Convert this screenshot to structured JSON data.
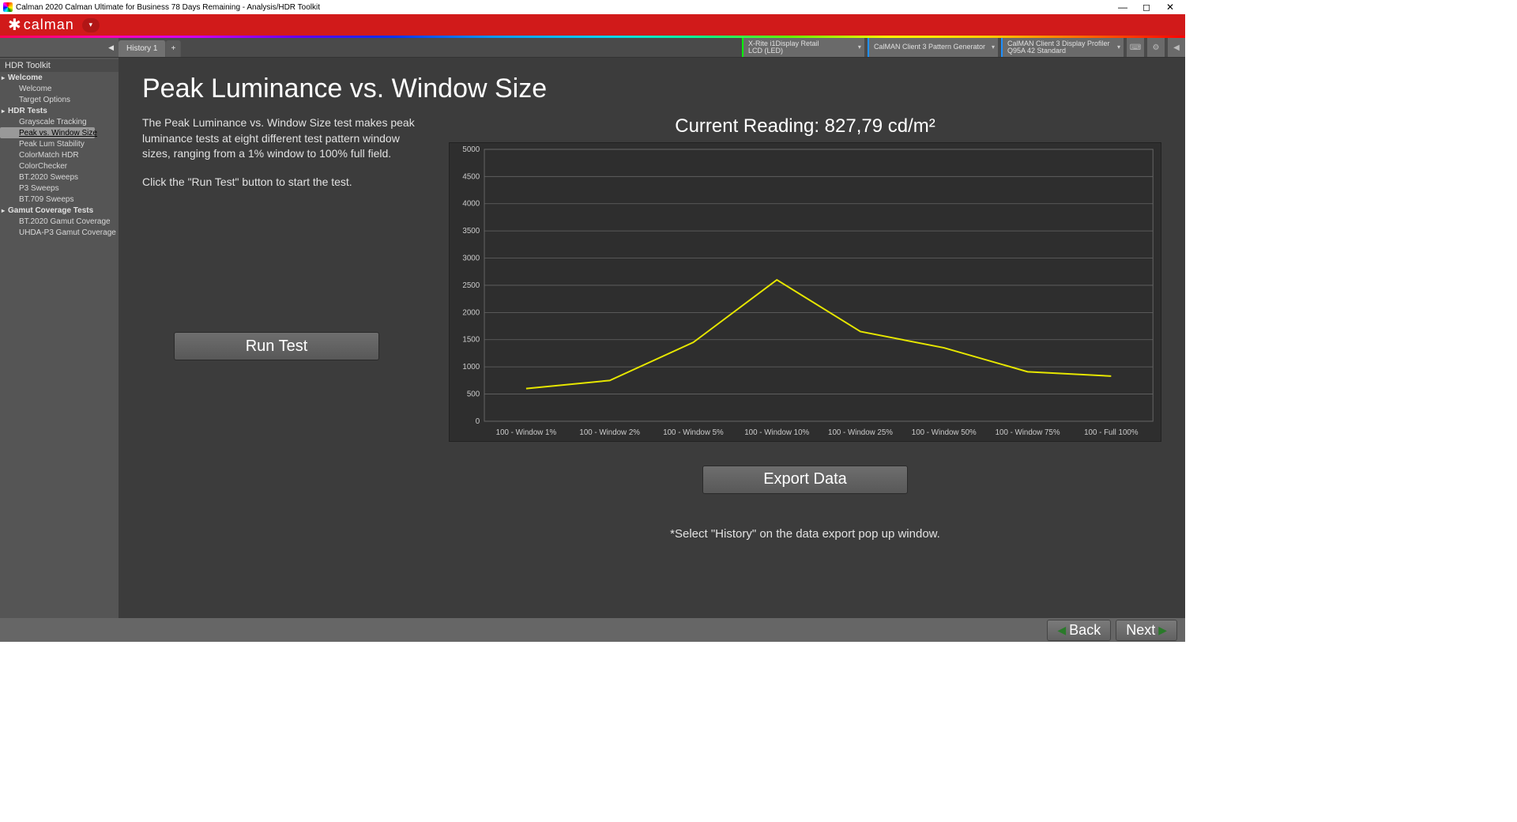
{
  "titlebar": {
    "title": "Calman 2020 Calman Ultimate for Business 78 Days Remaining  - Analysis/HDR Toolkit"
  },
  "brand": "calman",
  "tabs": {
    "history1": "History 1"
  },
  "devices": {
    "d1a": "X-Rite i1Display Retail",
    "d1b": "LCD (LED)",
    "d2a": "CalMAN Client 3 Pattern Generator",
    "d2b": "",
    "d3a": "CalMAN Client 3 Display Profiler",
    "d3b": "Q95A 42 Standard"
  },
  "sidebar": {
    "title": "HDR Toolkit",
    "s1": "Welcome",
    "s1a": "Welcome",
    "s1b": "Target Options",
    "s2": "HDR Tests",
    "s2a": "Grayscale Tracking",
    "s2b": "Peak vs. Window Size",
    "s2c": "Peak Lum Stability",
    "s2d": "ColorMatch HDR",
    "s2e": "ColorChecker",
    "s2f": "BT.2020 Sweeps",
    "s2g": "P3 Sweeps",
    "s2h": "BT.709 Sweeps",
    "s3": "Gamut Coverage Tests",
    "s3a": "BT.2020 Gamut Coverage",
    "s3b": "UHDA-P3 Gamut Coverage"
  },
  "page": {
    "heading": "Peak Luminance vs. Window Size",
    "desc1": "The Peak Luminance vs. Window Size test makes peak luminance tests at eight different test pattern window sizes, ranging from a 1% window to 100% full field.",
    "desc2": "Click the \"Run Test\" button to start the test.",
    "run_label": "Run Test",
    "reading_prefix": "Current Reading: ",
    "reading_value": "827,79 cd/m²",
    "export_label": "Export  Data",
    "note": "*Select \"History\" on the data export pop up window."
  },
  "footer": {
    "back": "Back",
    "next": "Next"
  },
  "chart_data": {
    "type": "line",
    "title": "",
    "xlabel": "",
    "ylabel": "",
    "ylim": [
      0,
      5000
    ],
    "ygrid_step": 500,
    "categories": [
      "100 - Window  1%",
      "100 - Window  2%",
      "100 - Window  5%",
      "100 - Window 10%",
      "100 - Window 25%",
      "100 - Window 50%",
      "100 - Window 75%",
      "100 - Full  100%"
    ],
    "values": [
      600,
      750,
      1450,
      2600,
      1650,
      1350,
      910,
      830
    ]
  }
}
